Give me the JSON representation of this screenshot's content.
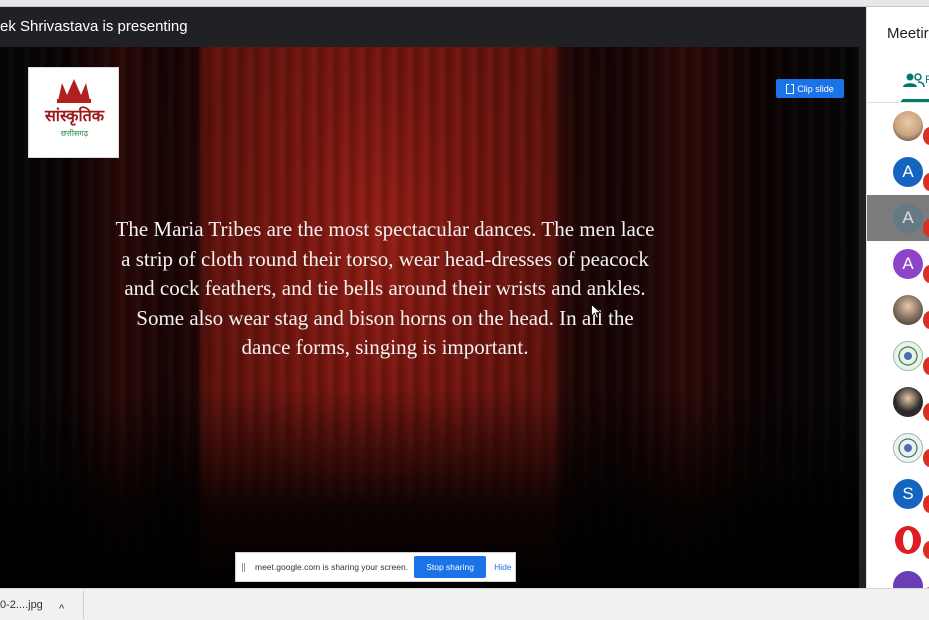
{
  "presenter": {
    "banner": "ek Shrivastava is presenting"
  },
  "slide": {
    "logo_text": "सांस्कृतिक",
    "logo_subtext": "छत्तीसगढ़",
    "clip_button": "Clip slide",
    "body_text": "The Maria Tribes are the most spectacular dances. The men lace a strip of cloth round their torso, wear head-dresses of peacock and cock feathers, and tie bells around their wrists and ankles. Some also wear stag and bison horns on the head. In all the dance forms, singing is important."
  },
  "share_bar": {
    "message": "meet.google.com is sharing your screen.",
    "stop_label": "Stop sharing",
    "hide_label": "Hide"
  },
  "sidebar": {
    "title": "Meetir",
    "tab_label": "P",
    "participants": [
      {
        "kind": "photo",
        "color": "#c9a27e",
        "letter": ""
      },
      {
        "kind": "letter",
        "color": "#1565c0",
        "letter": "A"
      },
      {
        "kind": "letter",
        "color": "#5f7a8a",
        "letter": "A",
        "selected": true
      },
      {
        "kind": "letter",
        "color": "#8e44c8",
        "letter": "A"
      },
      {
        "kind": "photo",
        "color": "#7a6a5a",
        "letter": ""
      },
      {
        "kind": "emblem",
        "color": "#e9f3ea",
        "letter": ""
      },
      {
        "kind": "photo",
        "color": "#2a2a2a",
        "letter": ""
      },
      {
        "kind": "emblem",
        "color": "#eef2f7",
        "letter": ""
      },
      {
        "kind": "letter",
        "color": "#1565c0",
        "letter": "S"
      },
      {
        "kind": "opera",
        "color": "#ffffff",
        "letter": ""
      },
      {
        "kind": "letter",
        "color": "#6a3fb5",
        "letter": ""
      }
    ]
  },
  "download_shelf": {
    "file_name": "0-2....jpg",
    "caret": "^"
  }
}
